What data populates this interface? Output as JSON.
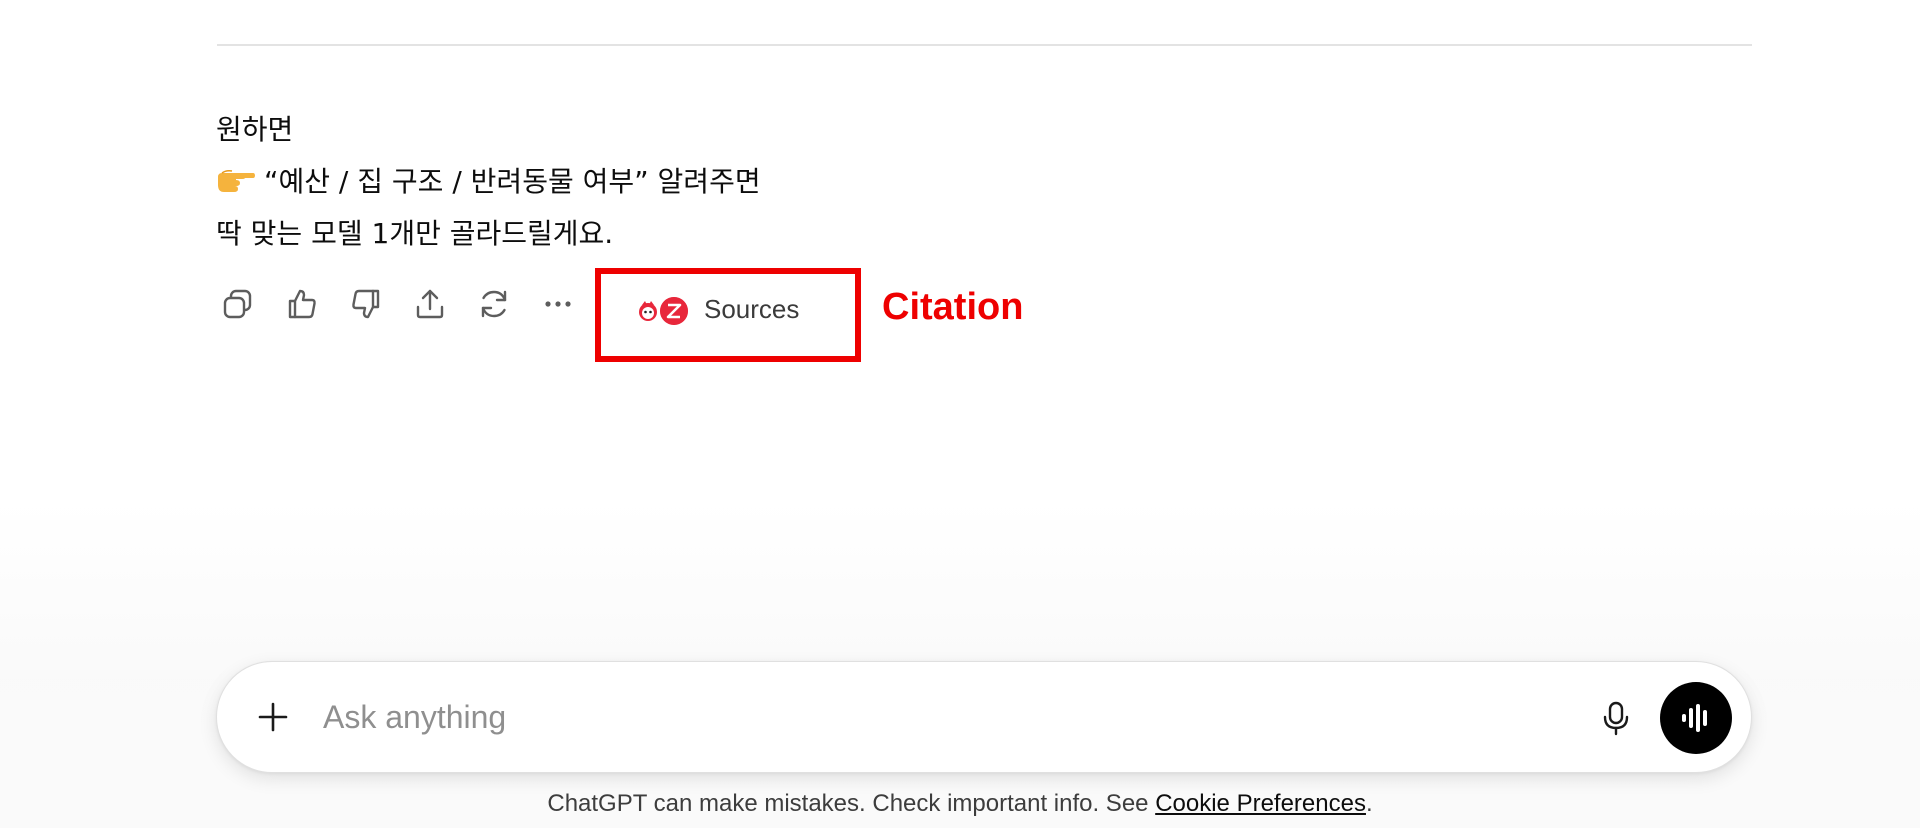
{
  "message": {
    "line1": "원하면",
    "line2_text": "“예산 / 집 구조 / 반려동물 여부” 알려주면",
    "line3": "딱 맞는 모델 1개만 골라드릴게요.",
    "pointer_icon": "backhand-index-pointing-right-emoji"
  },
  "actions": {
    "items": [
      {
        "name": "copy",
        "icon": "copy-icon"
      },
      {
        "name": "thumbs-up",
        "icon": "thumbs-up-icon"
      },
      {
        "name": "thumbs-down",
        "icon": "thumbs-down-icon"
      },
      {
        "name": "share",
        "icon": "share-icon"
      },
      {
        "name": "regenerate",
        "icon": "refresh-icon"
      },
      {
        "name": "more",
        "icon": "more-horizontal-icon"
      }
    ],
    "sources_label": "Sources",
    "source_icon_colors": [
      "#e8273b",
      "#e8273b"
    ]
  },
  "annotation": {
    "label": "Citation",
    "color": "#ee0000"
  },
  "composer": {
    "placeholder": "Ask anything",
    "value": ""
  },
  "footer": {
    "disclaimer_text": "ChatGPT can make mistakes. Check important info. See ",
    "link_text": "Cookie Preferences",
    "trailing": "."
  }
}
